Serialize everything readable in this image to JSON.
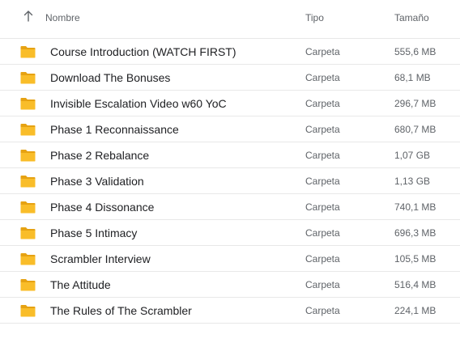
{
  "header": {
    "sort_icon": "arrow-up-icon",
    "name_label": "Nombre",
    "type_label": "Tipo",
    "size_label": "Tamaño"
  },
  "colors": {
    "folder": "#f9bd29",
    "folder_dark": "#e6a212",
    "divider": "#e8e8e8",
    "text_primary": "#202124",
    "text_secondary": "#5f6368"
  },
  "rows": [
    {
      "icon": "folder-icon",
      "name": "Course Introduction (WATCH FIRST)",
      "type": "Carpeta",
      "size": "555,6 MB"
    },
    {
      "icon": "folder-icon",
      "name": "Download The Bonuses",
      "type": "Carpeta",
      "size": "68,1 MB"
    },
    {
      "icon": "folder-icon",
      "name": "Invisible Escalation Video w60 YoC",
      "type": "Carpeta",
      "size": "296,7 MB"
    },
    {
      "icon": "folder-icon",
      "name": "Phase 1 Reconnaissance",
      "type": "Carpeta",
      "size": "680,7 MB"
    },
    {
      "icon": "folder-icon",
      "name": "Phase 2 Rebalance",
      "type": "Carpeta",
      "size": "1,07 GB"
    },
    {
      "icon": "folder-icon",
      "name": "Phase 3 Validation",
      "type": "Carpeta",
      "size": "1,13 GB"
    },
    {
      "icon": "folder-icon",
      "name": "Phase 4 Dissonance",
      "type": "Carpeta",
      "size": "740,1 MB"
    },
    {
      "icon": "folder-icon",
      "name": "Phase 5 Intimacy",
      "type": "Carpeta",
      "size": "696,3 MB"
    },
    {
      "icon": "folder-icon",
      "name": "Scrambler Interview",
      "type": "Carpeta",
      "size": "105,5 MB"
    },
    {
      "icon": "folder-icon",
      "name": "The Attitude",
      "type": "Carpeta",
      "size": "516,4 MB"
    },
    {
      "icon": "folder-icon",
      "name": "The Rules of The Scrambler",
      "type": "Carpeta",
      "size": "224,1 MB"
    }
  ]
}
